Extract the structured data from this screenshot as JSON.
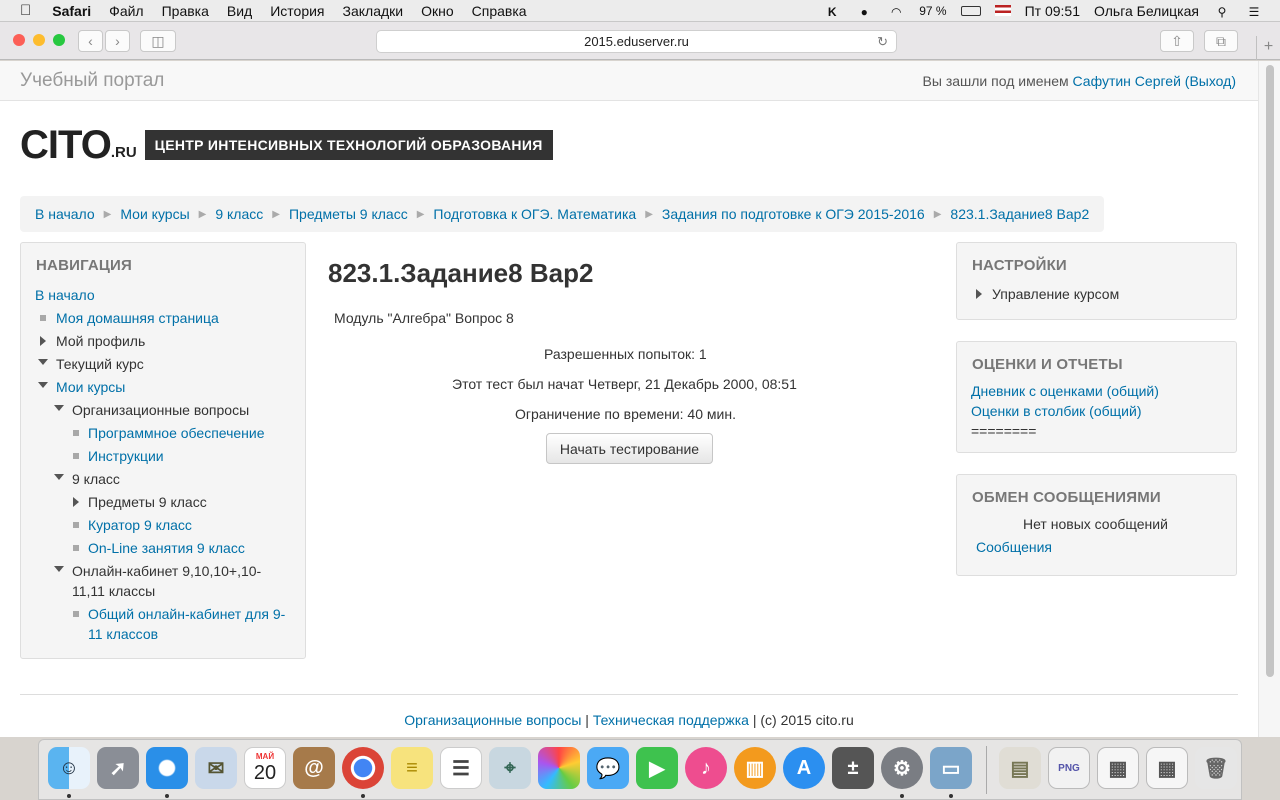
{
  "menubar": {
    "apple": "",
    "app": "Safari",
    "items": [
      "Файл",
      "Правка",
      "Вид",
      "История",
      "Закладки",
      "Окно",
      "Справка"
    ],
    "battery": "97 %",
    "clock": "Пт 09:51",
    "user": "Ольга Белицкая"
  },
  "browser": {
    "url": "2015.eduserver.ru",
    "newtab": "+"
  },
  "header": {
    "portal_title": "Учебный портал",
    "login_prefix": "Вы зашли под именем",
    "user": "Сафутин Сергей",
    "logout": "(Выход)"
  },
  "logo": {
    "cito": "CITO",
    "ru": ".RU",
    "tagline": "ЦЕНТР ИНТЕНСИВНЫХ ТЕХНОЛОГИЙ ОБРАЗОВАНИЯ"
  },
  "breadcrumb": [
    "В начало",
    "Мои курсы",
    "9 класс",
    "Предметы 9 класс",
    "Подготовка к ОГЭ. Математика",
    "Задания по подготовке к ОГЭ 2015-2016",
    "823.1.Задание8 Вар2"
  ],
  "navigation": {
    "title": "НАВИГАЦИЯ",
    "home": "В начало",
    "my_home": "Моя домашняя страница",
    "my_profile": "Мой профиль",
    "current_course": "Текущий курс",
    "my_courses": "Мои курсы",
    "org_questions": "Организационные вопросы",
    "software": "Программное обеспечение",
    "instructions": "Инструкции",
    "grade9": "9 класс",
    "subjects9": "Предметы 9 класс",
    "curator9": "Куратор 9 класс",
    "online9": "On-Line занятия 9 класс",
    "cabinet_line1": "Онлайн-кабинет 9,10,10+,10-",
    "cabinet_line2": "11,11 классы",
    "common_line1": "Общий онлайн-кабинет для 9-",
    "common_line2": "11 классов"
  },
  "main": {
    "title": "823.1.Задание8 Вар2",
    "module": "Модуль \"Алгебра\" Вопрос 8",
    "attempts": "Разрешенных попыток: 1",
    "started": "Этот тест был начат Четверг, 21 Декабрь 2000, 08:51",
    "time_limit": "Ограничение по времени: 40 мин.",
    "start_button": "Начать тестирование"
  },
  "settings": {
    "title": "НАСТРОЙКИ",
    "course_admin": "Управление курсом"
  },
  "grades": {
    "title": "ОЦЕНКИ И ОТЧЕТЫ",
    "diary": "Дневник с оценками (общий)",
    "column": "Оценки в столбик (общий)",
    "divider": "========"
  },
  "messages": {
    "title": "ОБМЕН СООБЩЕНИЯМИ",
    "none": "Нет новых сообщений",
    "link": "Сообщения"
  },
  "footer": {
    "org": "Организационные вопросы",
    "sep": " | ",
    "support": "Техническая поддержка",
    "copyright": " | (c) 2015 cito.ru"
  },
  "dock": {
    "calendar_month": "МАЙ",
    "calendar_day": "20"
  }
}
